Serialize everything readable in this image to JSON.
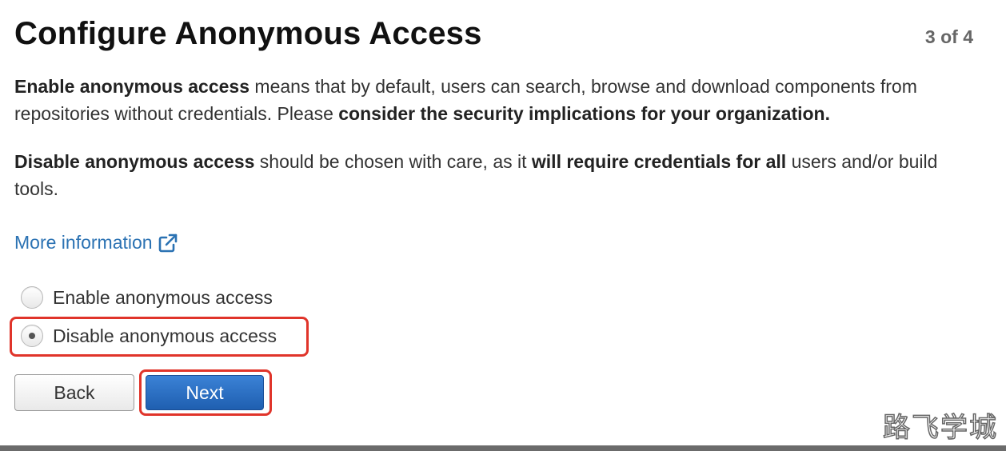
{
  "header": {
    "title": "Configure Anonymous Access",
    "step": "3 of 4"
  },
  "description": {
    "p1": {
      "bold1": "Enable anonymous access",
      "text1": " means that by default, users can search, browse and download components from repositories without credentials. Please ",
      "bold2": "consider the security implications for your organization."
    },
    "p2": {
      "bold1": "Disable anonymous access",
      "text1": " should be chosen with care, as it ",
      "bold2": "will require credentials for all",
      "text2": " users and/or build tools."
    }
  },
  "link": {
    "label": "More information",
    "icon": "external-link-icon",
    "color": "#2b72b3"
  },
  "options": [
    {
      "label": "Enable anonymous access",
      "checked": false
    },
    {
      "label": "Disable anonymous access",
      "checked": true
    }
  ],
  "buttons": {
    "back": "Back",
    "next": "Next"
  },
  "colors": {
    "primary": "#2b6fc4",
    "highlight": "#e0342a"
  },
  "watermark": "路飞学城"
}
